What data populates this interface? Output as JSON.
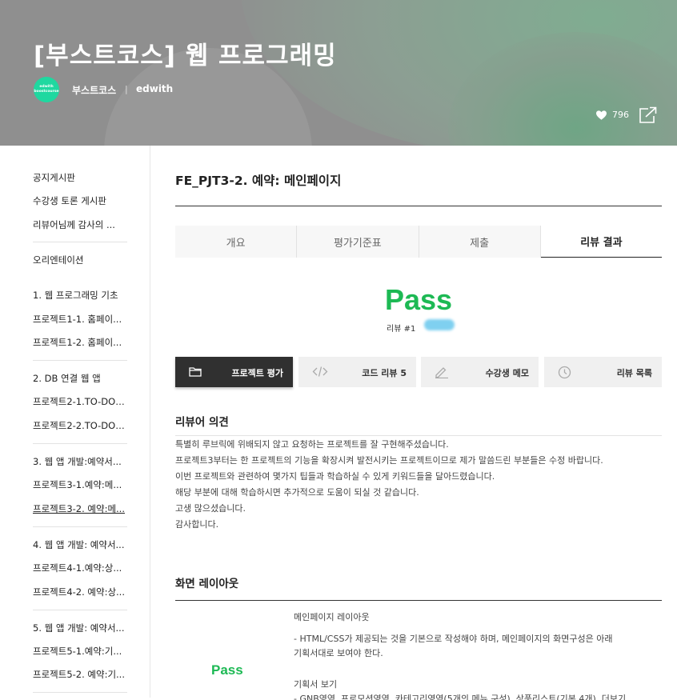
{
  "header": {
    "course_title": "[부스트코스] 웹 프로그래밍",
    "logo_text_line1": "edwith",
    "logo_text_line2": "boostcourse",
    "org_name": "부스트코스",
    "separator": "|",
    "org_sub": "edwith",
    "like_count": "796"
  },
  "sidebar": {
    "items": [
      {
        "label": "공지게시판"
      },
      {
        "label": "수강생 토론 게시판"
      },
      {
        "label": "리뷰어님께 감사의 ..."
      },
      {
        "label": "오리엔테이션"
      },
      {
        "label": "1. 웹 프로그래밍 기초"
      },
      {
        "label": "프로젝트1-1. 홈페이..."
      },
      {
        "label": "프로젝트1-2. 홈페이..."
      },
      {
        "label": "2. DB 연결 웹 앱"
      },
      {
        "label": "프로젝트2-1.TO-DO_..."
      },
      {
        "label": "프로젝트2-2.TO-DO_..."
      },
      {
        "label": "3. 웹 앱 개발:예약서..."
      },
      {
        "label": "프로젝트3-1.예약:메..."
      },
      {
        "label": "프로젝트3-2. 예약:메..."
      },
      {
        "label": "4. 웹 앱 개발: 예약서..."
      },
      {
        "label": "프로젝트4-1.예약:상..."
      },
      {
        "label": "프로젝트4-2. 예약:상..."
      },
      {
        "label": "5. 웹 앱 개발: 예약서..."
      },
      {
        "label": "프로젝트5-1.예약:기..."
      },
      {
        "label": "프로젝트5-2. 예약:기..."
      }
    ]
  },
  "main": {
    "page_title": "FE_PJT3-2. 예약: 메인페이지",
    "tabs": [
      {
        "label": "개요"
      },
      {
        "label": "평가기준표"
      },
      {
        "label": "제출"
      },
      {
        "label": "리뷰 결과"
      }
    ],
    "result": {
      "status": "Pass",
      "review_label": "리뷰 #1"
    },
    "buttons": [
      {
        "label": "프로젝트 평가",
        "icon": "folder-icon"
      },
      {
        "label": "코드 리뷰 5",
        "icon": "code-icon"
      },
      {
        "label": "수강생 메모",
        "icon": "pencil-icon"
      },
      {
        "label": "리뷰 목록",
        "icon": "clock-icon"
      }
    ],
    "reviewer_section": {
      "title": "리뷰어 의견",
      "lines": [
        "특별히 루브릭에 위배되지 않고 요청하는 프로젝트를 잘 구현해주셨습니다.",
        "프로젝트3부터는 한 프로젝트의 기능을 확장시켜 발전시키는 프로젝트이므로 제가 말씀드린 부분들은 수정 바랍니다.",
        "이번 프로젝트와 관련하여 몇가지 팁들과 학습하실 수 있게 키워드들을 달아드렸습니다.",
        "해당 부분에 대해 학습하시면 추가적으로 도움이 되실 것 같습니다.",
        "고생 많으셨습니다.",
        "감사합니다."
      ]
    },
    "layout_section": {
      "title": "화면 레이아웃",
      "status": "Pass",
      "heading": "메인페이지 레이아웃",
      "desc_line1": "- HTML/CSS가 제공되는 것을 기본으로 작성해야 하며, 메인페이지의 화면구성은 아래",
      "desc_line2": "기획서대로 보여야 한다.",
      "plan_label": "기획서 보기",
      "partial_line": "- GNB영역, 프로모션영역, 카테고리영역(5개의 메뉴 구성), 상품리스트(기본 4개), 더보기"
    }
  },
  "colors": {
    "pass_green": "#1db954",
    "banner_gray": "#8f8f8f",
    "dark_button": "#303030"
  }
}
